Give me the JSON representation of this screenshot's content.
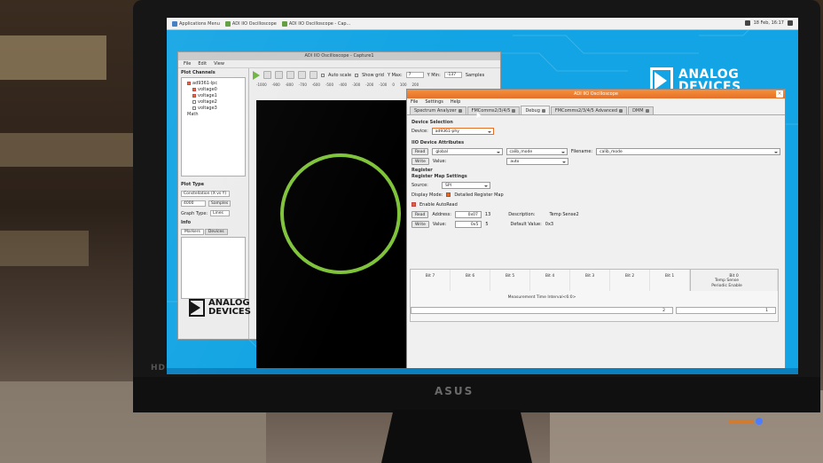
{
  "topbar": {
    "apps_menu": "Applications Menu",
    "task1": "ADI IIO Oscilloscope",
    "task2": "ADI IIO Oscilloscope - Cap...",
    "clock": "18 Feb, 16:17"
  },
  "brand": {
    "line1": "ANALOG",
    "line2": "DEVICES"
  },
  "capture_window": {
    "title": "ADI IIO Oscilloscope - Capture1",
    "menu": [
      "File",
      "Edit",
      "View"
    ],
    "plot_channels_label": "Plot Channels",
    "device": "ad9361-lpc",
    "channels": [
      {
        "name": "voltage0",
        "checked": true
      },
      {
        "name": "voltage1",
        "checked": true
      },
      {
        "name": "voltage2",
        "checked": false
      },
      {
        "name": "voltage3",
        "checked": false
      }
    ],
    "math_label": "Math",
    "plot_type_label": "Plot Type",
    "plot_type_value": "Constellation (X vs Y)",
    "samples_value": "4000",
    "samples_label": "Samples",
    "graph_type_label": "Graph Type:",
    "graph_type_value": "Lines",
    "info_label": "Info",
    "info_tabs": [
      "Markers",
      "Devices"
    ],
    "toolbar": {
      "auto_scale": "Auto scale",
      "show_grid": "Show grid",
      "y_max_label": "Y Max:",
      "y_max_value": "7",
      "y_min_label": "Y Min:",
      "y_min_value": "-137",
      "samples": "Samples"
    },
    "ruler_ticks": [
      "-1000",
      "-900",
      "-800",
      "-700",
      "-600",
      "-500",
      "-400",
      "-300",
      "-200",
      "-100",
      "0",
      "100",
      "200"
    ]
  },
  "main_window": {
    "title": "ADI IIO Oscilloscope",
    "menu": [
      "File",
      "Settings",
      "Help"
    ],
    "tabs": [
      {
        "label": "Spectrum Analyzer",
        "active": false
      },
      {
        "label": "FMComms2/3/4/5",
        "active": false
      },
      {
        "label": "Debug",
        "active": true
      },
      {
        "label": "FMComms2/3/4/5 Advanced",
        "active": false
      },
      {
        "label": "DMM",
        "active": false
      }
    ],
    "device_selection_label": "Device Selection",
    "device_label": "Device:",
    "device_value": "ad9361-phy",
    "attrs_label": "IIO Device Attributes",
    "read_label": "Read",
    "read_scope": "global",
    "read_attr": "calib_mode",
    "filename_label": "Filename:",
    "filename_value": "calib_mode",
    "write_label": "Write",
    "value_label": "Value:",
    "write_value": "auto",
    "register_label": "Register",
    "reg_map_label": "Register Map Settings",
    "source_label": "Source:",
    "source_value": "SPI",
    "display_mode_label": "Display Mode:",
    "detailed_map_label": "Detailed Register Map",
    "autoread_label": "Enable AutoRead",
    "address_label": "Address:",
    "address_value": "0x07",
    "address_dec": "13",
    "write_reg_value": "0x5",
    "write_reg_dec": "5",
    "description_label": "Description:",
    "description_value": "Temp Sense2",
    "default_value_label": "Default Value:",
    "default_value": "0x3",
    "bits": [
      "Bit 7",
      "Bit 6",
      "Bit 5",
      "Bit 4",
      "Bit 3",
      "Bit 2",
      "Bit 1",
      "Bit 0"
    ],
    "field_measurement": "Measurement Time Interval<6:0>",
    "field_measurement_value": "2",
    "field_temp_line1": "Temp Sense",
    "field_temp_line2": "Periodic Enable",
    "field_temp_value": "1"
  },
  "monitor": {
    "port_label": "HDMI",
    "brand": "ASUS"
  },
  "colors": {
    "desktop": "#12a4e4",
    "title_orange": "#e4702a",
    "trace_green": "#7fc33a"
  },
  "chart_data": {
    "type": "scatter",
    "description_shape": "circle"
  }
}
